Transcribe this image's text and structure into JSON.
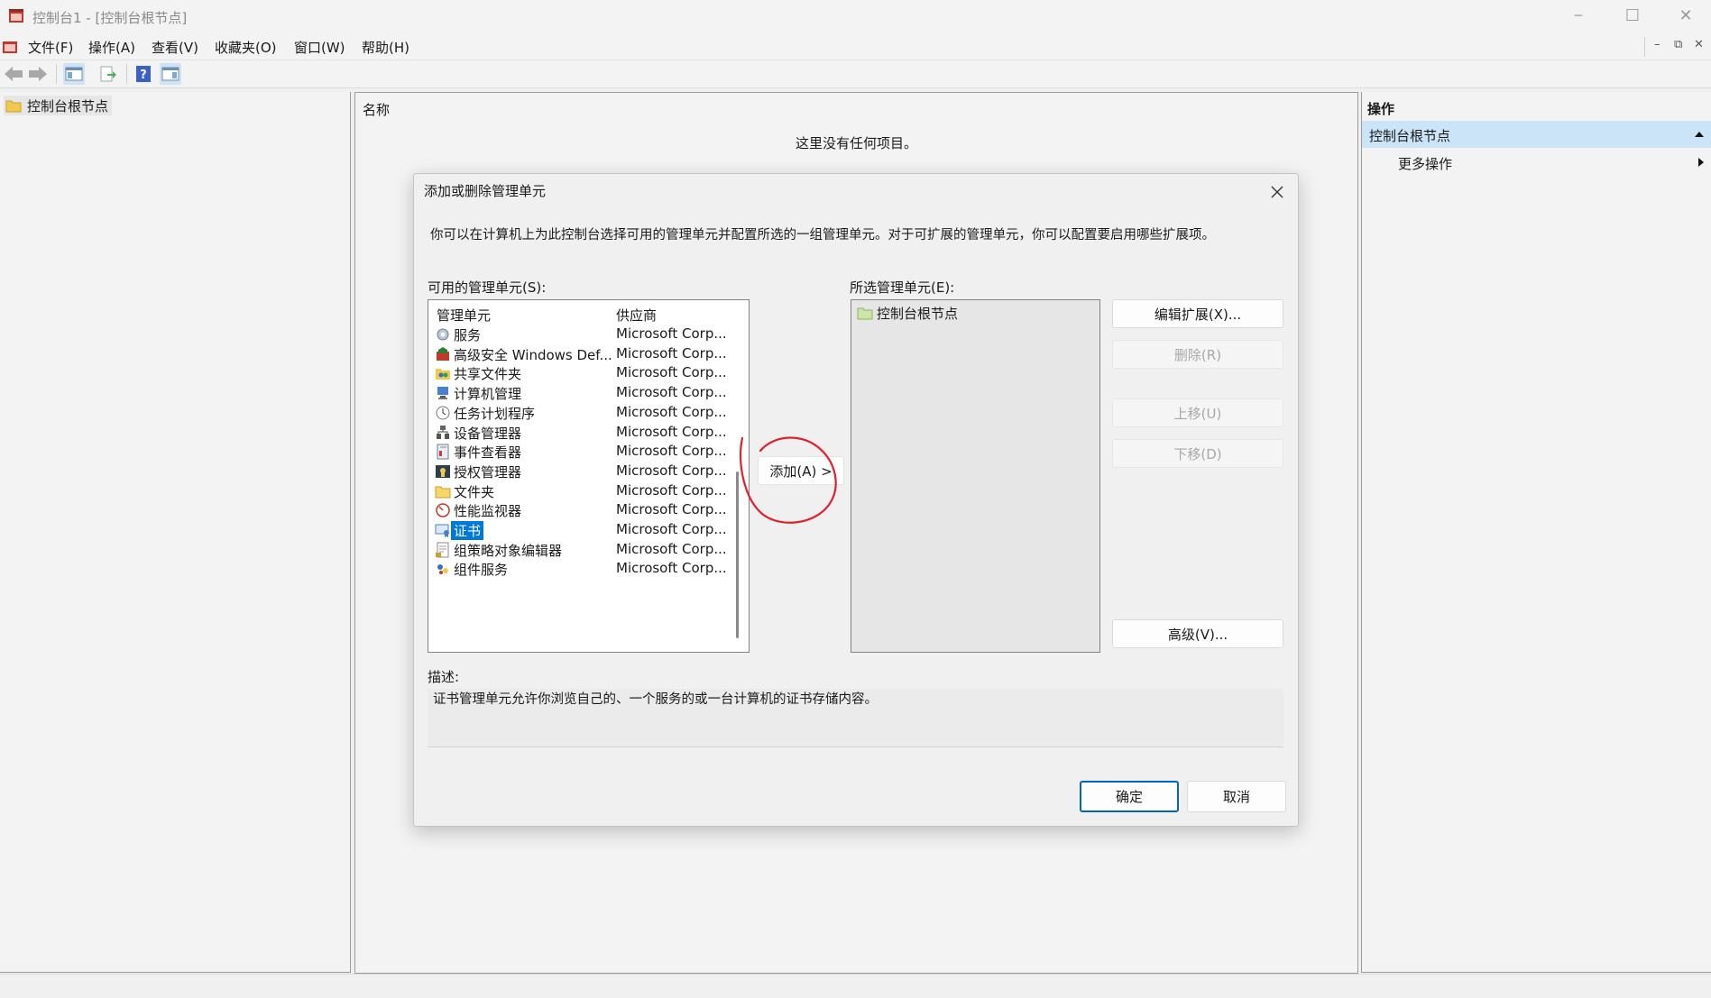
{
  "window": {
    "title": "控制台1 - [控制台根节点]",
    "minimize": "─",
    "maximize": "☐",
    "close": "✕"
  },
  "menubar": {
    "items": [
      "文件(F)",
      "操作(A)",
      "查看(V)",
      "收藏夹(O)",
      "窗口(W)",
      "帮助(H)"
    ],
    "mdi": [
      "–",
      "⧉",
      "✕"
    ]
  },
  "tree": {
    "root": "控制台根节点"
  },
  "center": {
    "column_name": "名称",
    "empty_text": "这里没有任何项目。"
  },
  "actions": {
    "header": "操作",
    "section": "控制台根节点",
    "more": "更多操作"
  },
  "dialog": {
    "title": "添加或删除管理单元",
    "intro": "你可以在计算机上为此控制台选择可用的管理单元并配置所选的一组管理单元。对于可扩展的管理单元，你可以配置要启用哪些扩展项。",
    "available_label": "可用的管理单元(S):",
    "columns": {
      "name": "管理单元",
      "vendor": "供应商"
    },
    "snapins": [
      {
        "name": "服务",
        "vendor": "Microsoft Corp...",
        "icon": "gear-icon"
      },
      {
        "name": "高级安全 Windows Def...",
        "vendor": "Microsoft Corp...",
        "icon": "firewall-icon"
      },
      {
        "name": "共享文件夹",
        "vendor": "Microsoft Corp...",
        "icon": "shared-folder-icon"
      },
      {
        "name": "计算机管理",
        "vendor": "Microsoft Corp...",
        "icon": "computer-management-icon"
      },
      {
        "name": "任务计划程序",
        "vendor": "Microsoft Corp...",
        "icon": "clock-icon"
      },
      {
        "name": "设备管理器",
        "vendor": "Microsoft Corp...",
        "icon": "device-icon"
      },
      {
        "name": "事件查看器",
        "vendor": "Microsoft Corp...",
        "icon": "event-log-icon"
      },
      {
        "name": "授权管理器",
        "vendor": "Microsoft Corp...",
        "icon": "authorization-icon"
      },
      {
        "name": "文件夹",
        "vendor": "Microsoft Corp...",
        "icon": "folder-icon"
      },
      {
        "name": "性能监视器",
        "vendor": "Microsoft Corp...",
        "icon": "gauge-icon"
      },
      {
        "name": "证书",
        "vendor": "Microsoft Corp...",
        "icon": "certificate-icon",
        "selected": true
      },
      {
        "name": "组策略对象编辑器",
        "vendor": "Microsoft Corp...",
        "icon": "policy-icon"
      },
      {
        "name": "组件服务",
        "vendor": "Microsoft Corp...",
        "icon": "component-icon"
      }
    ],
    "add_button": "添加(A) >",
    "selected_label": "所选管理单元(E):",
    "selected_items": [
      "控制台根节点"
    ],
    "buttons": {
      "edit_ext": "编辑扩展(X)...",
      "remove": "删除(R)",
      "move_up": "上移(U)",
      "move_down": "下移(D)",
      "advanced": "高级(V)..."
    },
    "description_label": "描述:",
    "description": "证书管理单元允许你浏览自己的、一个服务的或一台计算机的证书存储内容。",
    "ok": "确定",
    "cancel": "取消"
  },
  "colors": {
    "accent": "#0078d7",
    "selection_bar": "#cce4f7",
    "annotation": "#e0202a"
  }
}
